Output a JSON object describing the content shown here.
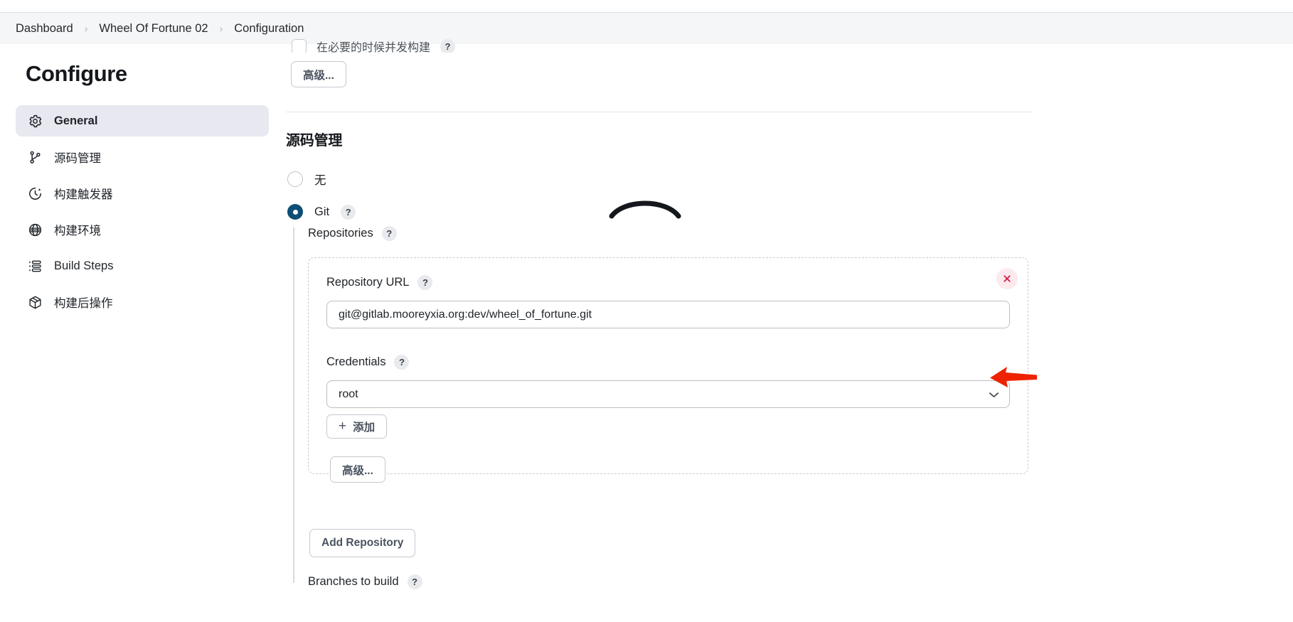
{
  "breadcrumb": {
    "items": [
      {
        "label": "Dashboard"
      },
      {
        "label": "Wheel Of Fortune 02"
      },
      {
        "label": "Configuration"
      }
    ],
    "separator": "›"
  },
  "sidebar": {
    "title": "Configure",
    "items": [
      {
        "label": "General",
        "icon": "gear-icon",
        "active": true
      },
      {
        "label": "源码管理",
        "icon": "branch-icon",
        "active": false
      },
      {
        "label": "构建触发器",
        "icon": "clock-icon",
        "active": false
      },
      {
        "label": "构建环境",
        "icon": "globe-icon",
        "active": false
      },
      {
        "label": "Build Steps",
        "icon": "list-steps-icon",
        "active": false
      },
      {
        "label": "构建后操作",
        "icon": "package-icon",
        "active": false
      }
    ]
  },
  "main": {
    "top_partial": {
      "checkbox_label": "在必要的时候并发构建",
      "checkbox_help": "?",
      "advanced_button": "高级..."
    },
    "scm": {
      "section_title": "源码管理",
      "options": [
        {
          "label": "无",
          "selected": false,
          "help": null
        },
        {
          "label": "Git",
          "selected": true,
          "help": "?"
        }
      ],
      "repositories_label": "Repositories",
      "repositories_help": "?",
      "repository": {
        "url_label": "Repository URL",
        "url_help": "?",
        "url_value": "git@gitlab.mooreyxia.org:dev/wheel_of_fortune.git",
        "credentials_label": "Credentials",
        "credentials_help": "?",
        "credentials_value": "root",
        "add_credentials_button": "添加",
        "add_credentials_icon": "plus-icon",
        "advanced_button": "高级...",
        "remove_icon": "close-icon"
      },
      "add_repository_button": "Add Repository",
      "branches_label": "Branches to build",
      "branches_help": "?"
    }
  },
  "annotations": {
    "arrow_color": "#ee2200",
    "arrow_target": "credentials-dropdown",
    "arc_color": "#14181c",
    "arc_target": "add-credentials-button"
  }
}
